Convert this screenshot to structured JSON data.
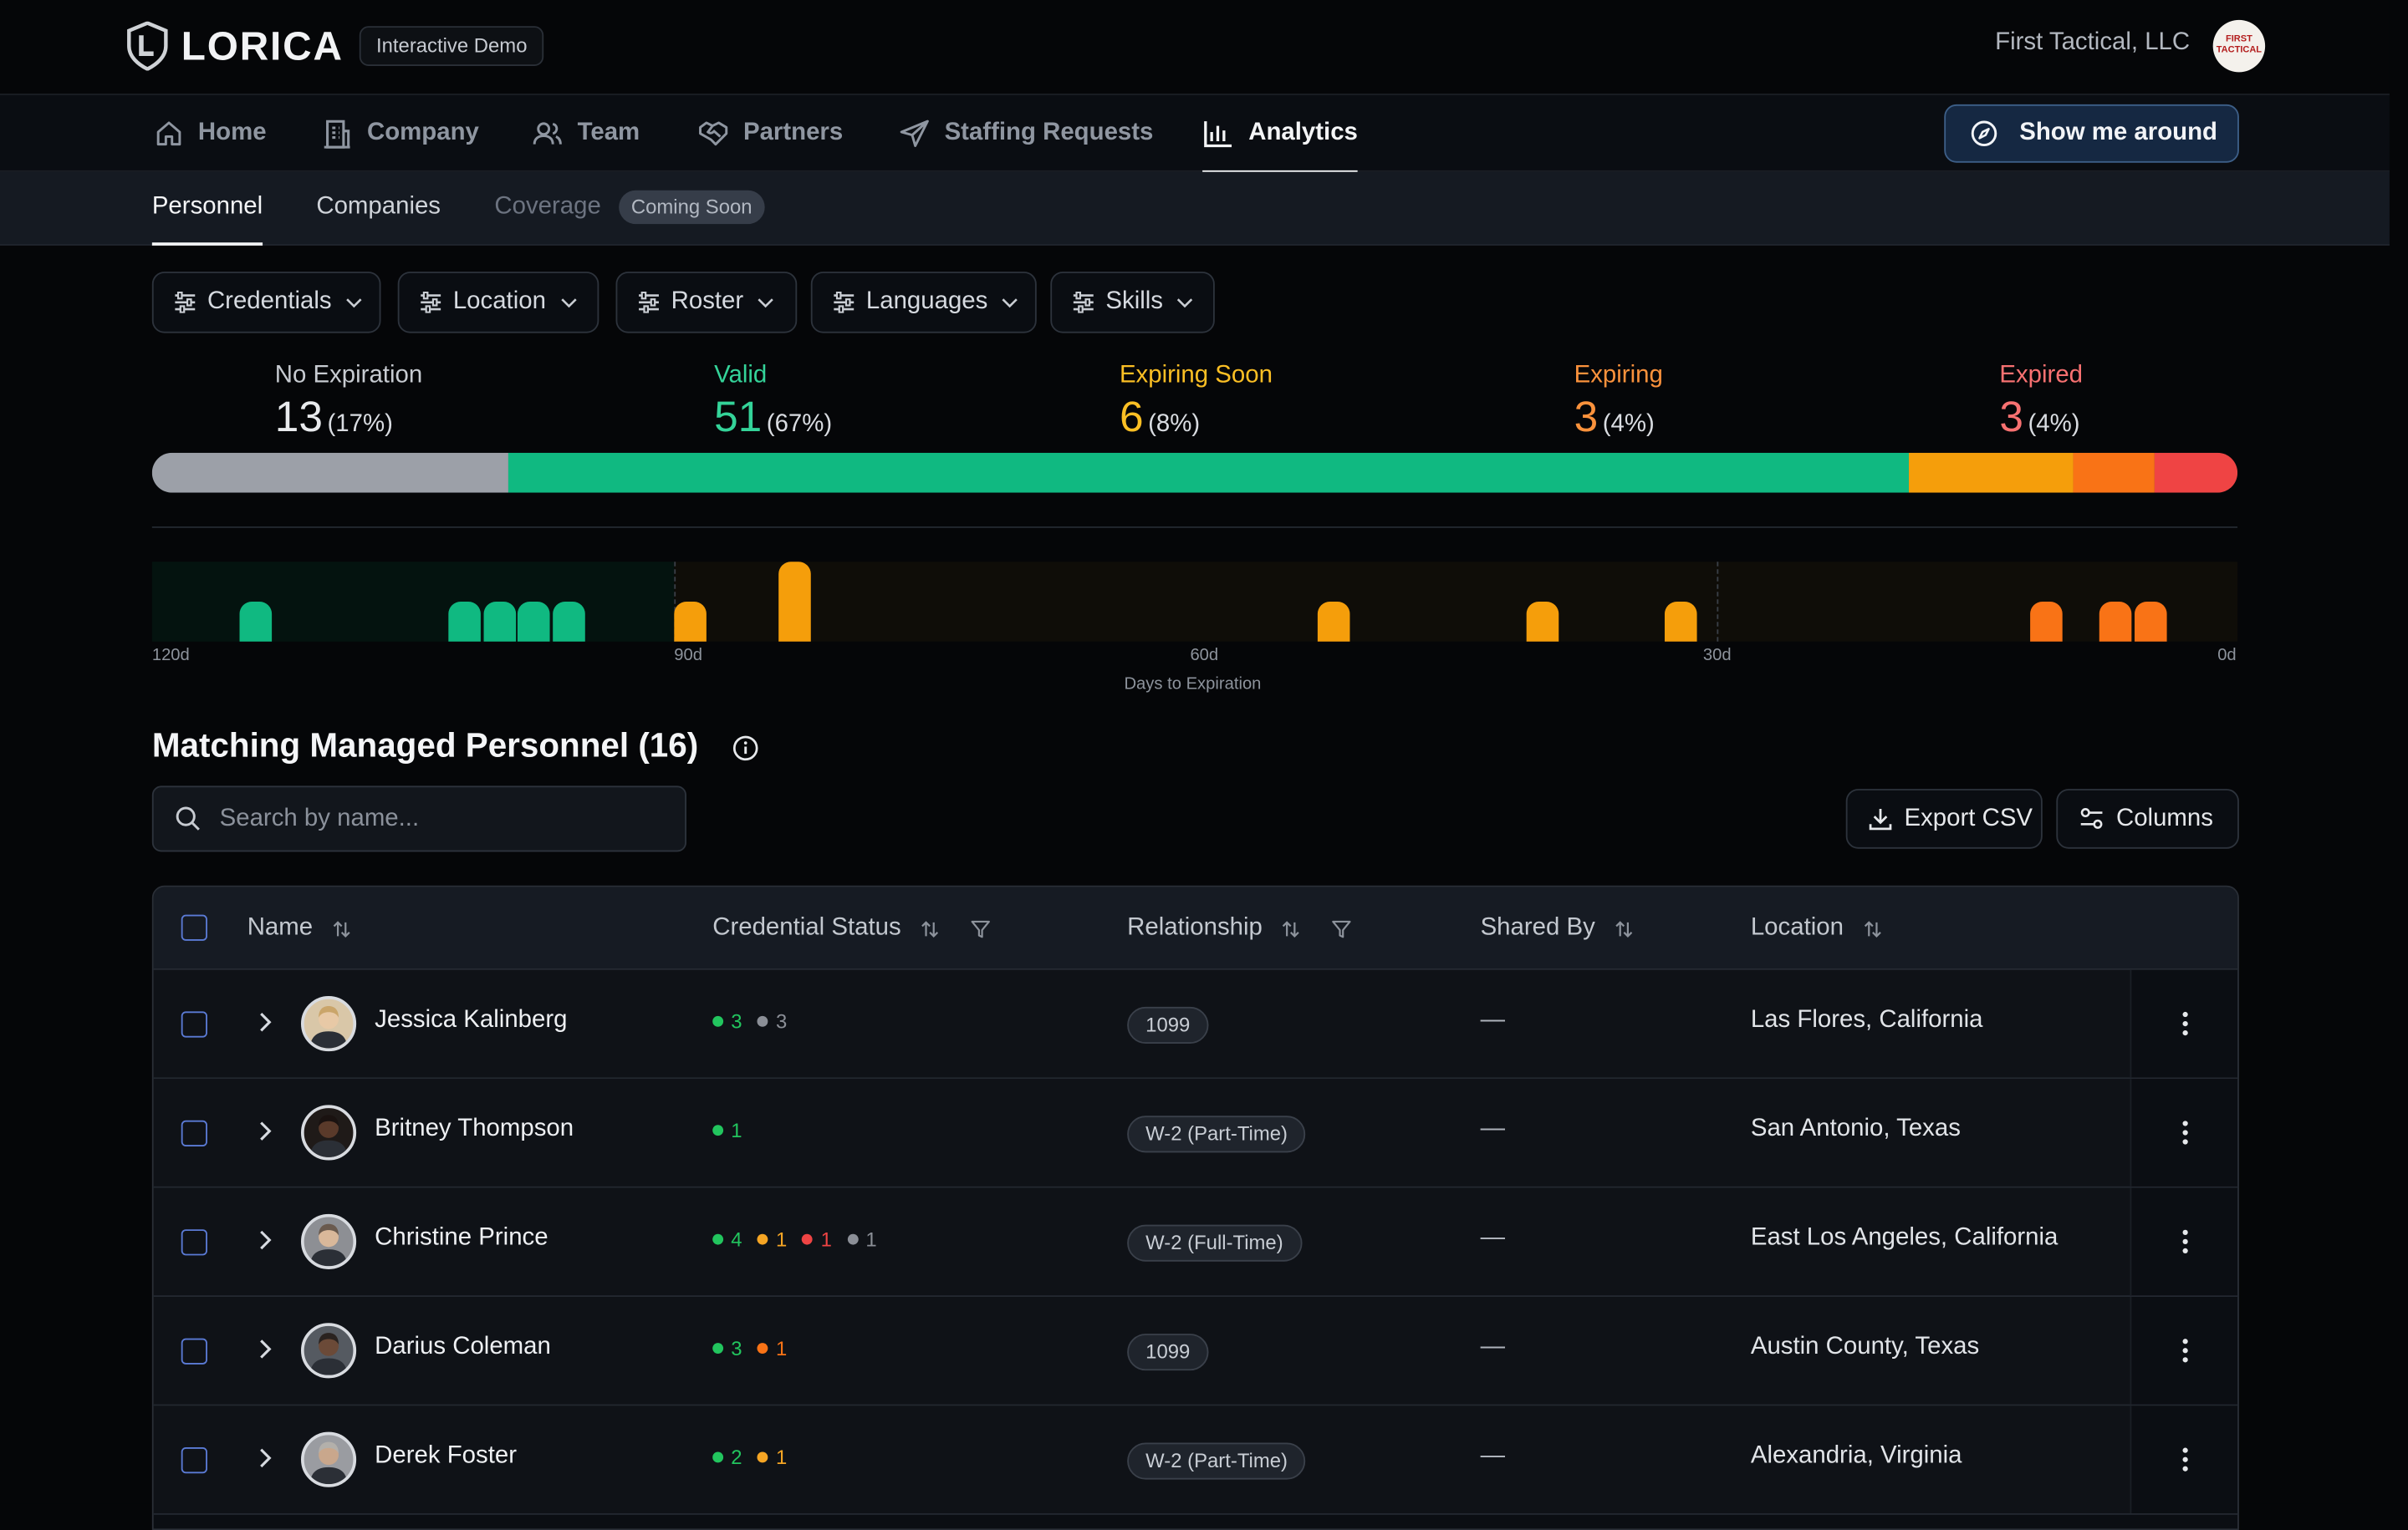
{
  "app": {
    "brand": "LORICA",
    "badge": "Interactive Demo",
    "company": "First Tactical, LLC",
    "company_logo_text": "FIRST TACTICAL"
  },
  "nav": {
    "items": [
      {
        "label": "Home",
        "icon": "home-icon"
      },
      {
        "label": "Company",
        "icon": "building-icon"
      },
      {
        "label": "Team",
        "icon": "users-icon"
      },
      {
        "label": "Partners",
        "icon": "handshake-icon"
      },
      {
        "label": "Staffing Requests",
        "icon": "send-icon"
      },
      {
        "label": "Analytics",
        "icon": "bar-chart-icon"
      }
    ],
    "active": "Analytics",
    "tour_button": "Show me around"
  },
  "subnav": {
    "items": [
      "Personnel",
      "Companies",
      "Coverage"
    ],
    "active": "Personnel",
    "coming_soon": "Coming Soon"
  },
  "filters": [
    "Credentials",
    "Location",
    "Roster",
    "Languages",
    "Skills"
  ],
  "stats": [
    {
      "label": "No Expiration",
      "value": "13",
      "pct": "(17%)",
      "color": "#9ca0a8"
    },
    {
      "label": "Valid",
      "value": "51",
      "pct": "(67%)",
      "color": "#22c58b"
    },
    {
      "label": "Expiring Soon",
      "value": "6",
      "pct": "(8%)",
      "color": "#f5a524"
    },
    {
      "label": "Expiring",
      "value": "3",
      "pct": "(4%)",
      "color": "#f97316"
    },
    {
      "label": "Expired",
      "value": "3",
      "pct": "(4%)",
      "color": "#f87171"
    }
  ],
  "histogram": {
    "ticks": [
      "120d",
      "90d",
      "60d",
      "30d",
      "0d"
    ],
    "caption": "Days to Expiration"
  },
  "table_section": {
    "title": "Matching Managed Personnel (16)",
    "search_placeholder": "Search by name...",
    "export_label": "Export CSV",
    "columns_label": "Columns",
    "headers": [
      "Name",
      "Credential Status",
      "Relationship",
      "Shared By",
      "Location"
    ],
    "rows": [
      {
        "name": "Jessica Kalinberg",
        "creds": [
          {
            "n": "3",
            "c": "#22c55e"
          },
          {
            "n": "3",
            "c": "#8b8f97"
          }
        ],
        "relationship": "1099",
        "shared": "—",
        "location": "Las Flores, California"
      },
      {
        "name": "Britney Thompson",
        "creds": [
          {
            "n": "1",
            "c": "#22c55e"
          }
        ],
        "relationship": "W-2 (Part-Time)",
        "shared": "—",
        "location": "San Antonio, Texas"
      },
      {
        "name": "Christine Prince",
        "creds": [
          {
            "n": "4",
            "c": "#22c55e"
          },
          {
            "n": "1",
            "c": "#f5a524"
          },
          {
            "n": "1",
            "c": "#ef4444"
          },
          {
            "n": "1",
            "c": "#8b8f97"
          }
        ],
        "relationship": "W-2 (Full-Time)",
        "shared": "—",
        "location": "East Los Angeles, California"
      },
      {
        "name": "Darius Coleman",
        "creds": [
          {
            "n": "3",
            "c": "#22c55e"
          },
          {
            "n": "1",
            "c": "#f97316"
          }
        ],
        "relationship": "1099",
        "shared": "—",
        "location": "Austin County, Texas"
      },
      {
        "name": "Derek Foster",
        "creds": [
          {
            "n": "2",
            "c": "#22c55e"
          },
          {
            "n": "1",
            "c": "#f5a524"
          }
        ],
        "relationship": "W-2 (Part-Time)",
        "shared": "—",
        "location": "Alexandria, Virginia"
      }
    ]
  },
  "chart_data": [
    {
      "type": "bar",
      "title": "",
      "categories": [
        "No Expiration",
        "Valid",
        "Expiring Soon",
        "Expiring",
        "Expired"
      ],
      "values": [
        13,
        51,
        6,
        3,
        3
      ],
      "colors": [
        "#9ca0a8",
        "#10b981",
        "#f59e0b",
        "#f97316",
        "#ef4444"
      ],
      "orientation": "stacked-horizontal"
    },
    {
      "type": "bar",
      "xlabel": "Days to Expiration",
      "xlim": [
        120,
        0
      ],
      "x_ticks": [
        "120d",
        "90d",
        "60d",
        "30d",
        "0d"
      ],
      "series": [
        {
          "values": [
            {
              "x": 114,
              "y": 1,
              "color": "#10b981"
            },
            {
              "x": 102,
              "y": 1,
              "color": "#10b981"
            },
            {
              "x": 100,
              "y": 1,
              "color": "#10b981"
            },
            {
              "x": 98,
              "y": 1,
              "color": "#10b981"
            },
            {
              "x": 96,
              "y": 1,
              "color": "#10b981"
            },
            {
              "x": 89,
              "y": 1,
              "color": "#f59e0b"
            },
            {
              "x": 83,
              "y": 2,
              "color": "#f59e0b"
            },
            {
              "x": 52,
              "y": 1,
              "color": "#f59e0b"
            },
            {
              "x": 40,
              "y": 1,
              "color": "#f59e0b"
            },
            {
              "x": 32,
              "y": 1,
              "color": "#f59e0b"
            },
            {
              "x": 11,
              "y": 1,
              "color": "#f97316"
            },
            {
              "x": 7,
              "y": 1,
              "color": "#f97316"
            },
            {
              "x": 5,
              "y": 1,
              "color": "#f97316"
            }
          ]
        }
      ]
    }
  ]
}
